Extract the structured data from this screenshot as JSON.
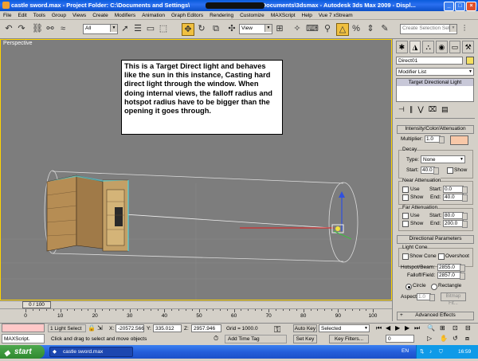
{
  "titlebar": {
    "title": "castle sword.max - Project Folder: C:\\Documents and Settings\\",
    "title_tail": "My Documents\\3dsmax - Autodesk 3ds Max 2009 - Displ..."
  },
  "menu": [
    "File",
    "Edit",
    "Tools",
    "Group",
    "Views",
    "Create",
    "Modifiers",
    "Animation",
    "Graph Editors",
    "Rendering",
    "Customize",
    "MAXScript",
    "Help",
    "Vue 7 xStream"
  ],
  "toolbar": {
    "filter_value": "All",
    "coord_value": "View",
    "named_selection_placeholder": "Create Selection Set"
  },
  "viewport": {
    "label": "Perspective",
    "note": "This is a Target Direct light and behaves like the sun in this instance, Casting hard direct light through the window. When doing internal views, the falloff radius and hotspot radius have to be bigger than the opening it goes through."
  },
  "command_panel": {
    "object_name": "Direct01",
    "modifier_list": "Modifier List",
    "stack_item": "Target Directional Light",
    "rollout_intensity": "Intensity/Color/Attenuation",
    "multiplier_label": "Multiplier:",
    "multiplier_value": "1.0",
    "decay_label": "Decay",
    "type_label": "Type:",
    "type_value": "None",
    "start_label": "Start:",
    "start_value": "40.0",
    "show_label": "Show",
    "near_atten_label": "Near Attenuation",
    "use_label": "Use",
    "near_start_value": "0.0",
    "end_label": "End:",
    "near_end_value": "40.0",
    "far_atten_label": "Far Attenuation",
    "far_start_value": "80.0",
    "far_end_value": "200.0",
    "rollout_directional": "Directional Parameters",
    "light_cone_label": "Light Cone",
    "show_cone_label": "Show Cone",
    "overshoot_label": "Overshoot",
    "hotspot_label": "Hotspot/Beam:",
    "hotspot_value": "2855.0",
    "falloff_label": "Falloff/Field:",
    "falloff_value": "2857.0",
    "circle_label": "Circle",
    "rectangle_label": "Rectangle",
    "aspect_label": "Aspect:",
    "aspect_value": "1.0",
    "bitmap_fit_label": "Bitmap Fit...",
    "rollout_advanced": "Advanced Effects",
    "colors": {
      "swatch": "#f8c8a8"
    }
  },
  "timeline": {
    "frame_label": "0 / 100",
    "ticks": [
      "0",
      "10",
      "20",
      "30",
      "40",
      "50",
      "60",
      "70",
      "80",
      "90",
      "100"
    ]
  },
  "status": {
    "selection": "1 Light Select",
    "x_label": "X:",
    "x_value": "-20572.566",
    "y_label": "Y:",
    "y_value": "335.012",
    "z_label": "Z:",
    "z_value": "2957.946",
    "grid": "Grid = 1000.0",
    "auto_key": "Auto Key",
    "selected": "Selected",
    "set_key": "Set Key",
    "key_filters": "Key Filters...",
    "frame_value": "0",
    "prompt": "Click and drag to select and move objects",
    "add_time_tag": "Add Time Tag",
    "maxscript": "MAXScript."
  },
  "taskbar": {
    "start": "start",
    "task": "castle sword.max",
    "lang": "EN",
    "clock": "16:59"
  }
}
